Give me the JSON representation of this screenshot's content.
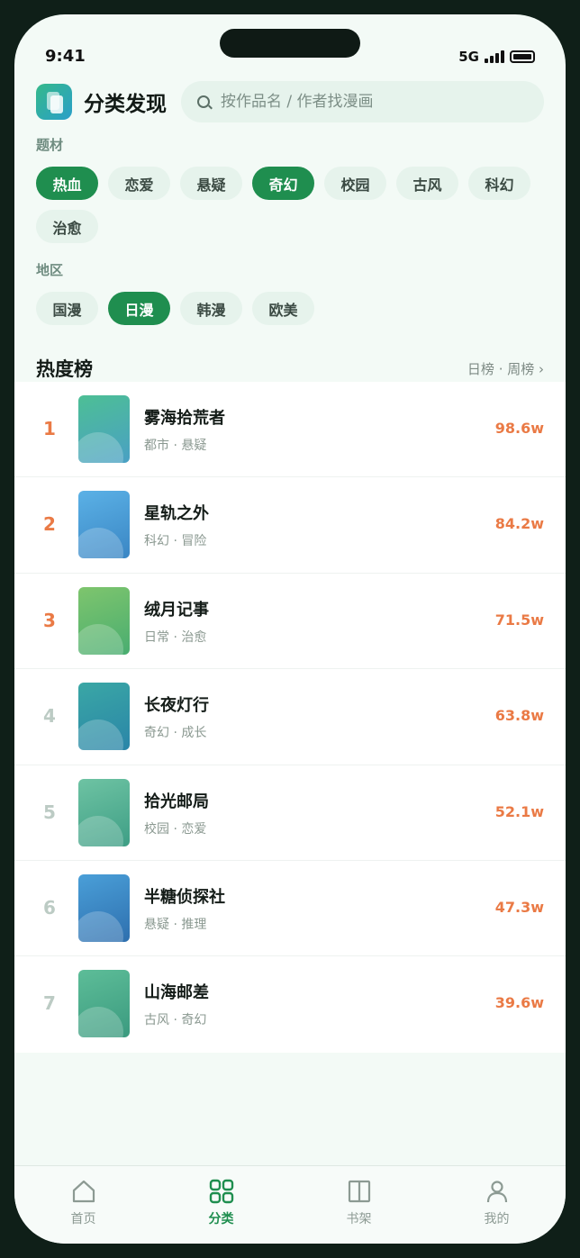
{
  "status": {
    "time": "9:41",
    "network": "5G"
  },
  "header": {
    "title": "分类发现",
    "search_placeholder": "按作品名 / 作者找漫画"
  },
  "genre": {
    "label": "题材",
    "chips": [
      {
        "label": "热血",
        "active": true
      },
      {
        "label": "恋爱",
        "active": false
      },
      {
        "label": "悬疑",
        "active": false
      },
      {
        "label": "奇幻",
        "active": true
      },
      {
        "label": "校园",
        "active": false
      },
      {
        "label": "古风",
        "active": false
      },
      {
        "label": "科幻",
        "active": false
      },
      {
        "label": "治愈",
        "active": false
      }
    ]
  },
  "region": {
    "label": "地区",
    "chips": [
      {
        "label": "国漫",
        "active": false
      },
      {
        "label": "日漫",
        "active": true
      },
      {
        "label": "韩漫",
        "active": false
      },
      {
        "label": "欧美",
        "active": false
      }
    ]
  },
  "ranking": {
    "title": "热度榜",
    "switch": "日榜 · 周榜 ›",
    "items": [
      {
        "rank": "1",
        "name": "雾海拾荒者",
        "meta": "都市 · 悬疑",
        "heat": "98.6w",
        "colors": [
          "#4dbf95",
          "#4aa0c4"
        ]
      },
      {
        "rank": "2",
        "name": "星轨之外",
        "meta": "科幻 · 冒险",
        "heat": "84.2w",
        "colors": [
          "#5bb1e6",
          "#3a86c4"
        ]
      },
      {
        "rank": "3",
        "name": "绒月记事",
        "meta": "日常 · 治愈",
        "heat": "71.5w",
        "colors": [
          "#7ec56d",
          "#49ad70"
        ]
      },
      {
        "rank": "4",
        "name": "长夜灯行",
        "meta": "奇幻 · 成长",
        "heat": "63.8w",
        "colors": [
          "#3aa7a5",
          "#2a85a8"
        ]
      },
      {
        "rank": "5",
        "name": "拾光邮局",
        "meta": "校园 · 恋爱",
        "heat": "52.1w",
        "colors": [
          "#6ec3a3",
          "#3e9e85"
        ]
      },
      {
        "rank": "6",
        "name": "半糖侦探社",
        "meta": "悬疑 · 推理",
        "heat": "47.3w",
        "colors": [
          "#4a9fd8",
          "#2e6fae"
        ]
      },
      {
        "rank": "7",
        "name": "山海邮差",
        "meta": "古风 · 奇幻",
        "heat": "39.6w",
        "colors": [
          "#5dbd98",
          "#3b9a7f"
        ]
      }
    ]
  },
  "tabs": [
    {
      "label": "首页",
      "icon": "home-icon",
      "active": false
    },
    {
      "label": "分类",
      "icon": "grid-icon",
      "active": true
    },
    {
      "label": "书架",
      "icon": "bookshelf-icon",
      "active": false
    },
    {
      "label": "我的",
      "icon": "user-icon",
      "active": false
    }
  ],
  "colors": {
    "accent": "#1f8e4f",
    "heat": "#ea7a45",
    "background": "#f3faf6"
  }
}
